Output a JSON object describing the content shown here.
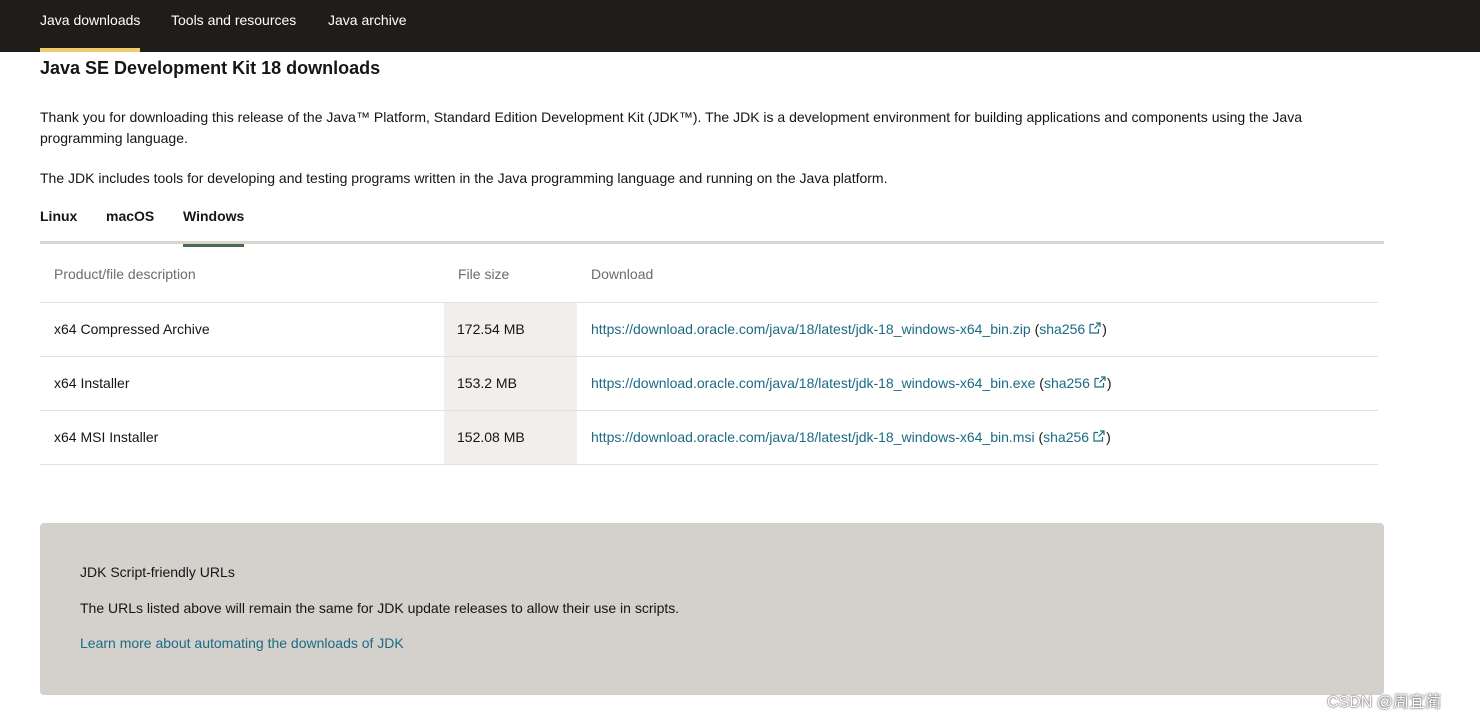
{
  "nav": {
    "items": [
      {
        "label": "Java downloads"
      },
      {
        "label": "Tools and resources"
      },
      {
        "label": "Java archive"
      }
    ]
  },
  "page": {
    "title": "Java SE Development Kit 18 downloads",
    "intro": "Thank you for downloading this release of the Java™ Platform, Standard Edition Development Kit (JDK™). The JDK is a development environment for building applications and components using the Java programming language.",
    "intro2": "The JDK includes tools for developing and testing programs written in the Java programming language and running on the Java platform."
  },
  "tabs": [
    {
      "label": "Linux"
    },
    {
      "label": "macOS"
    },
    {
      "label": "Windows"
    }
  ],
  "table": {
    "headers": [
      "Product/file description",
      "File size",
      "Download"
    ],
    "rows": [
      {
        "description": "x64 Compressed Archive",
        "size": "172.54 MB",
        "url": "https://download.oracle.com/java/18/latest/jdk-18_windows-x64_bin.zip",
        "checksum": "sha256"
      },
      {
        "description": "x64 Installer",
        "size": "153.2 MB",
        "url": "https://download.oracle.com/java/18/latest/jdk-18_windows-x64_bin.exe",
        "checksum": "sha256"
      },
      {
        "description": "x64 MSI Installer",
        "size": "152.08 MB",
        "url": "https://download.oracle.com/java/18/latest/jdk-18_windows-x64_bin.msi",
        "checksum": "sha256"
      }
    ]
  },
  "info_box": {
    "title": "JDK Script-friendly URLs",
    "text": "The URLs listed above will remain the same for JDK update releases to allow their use in scripts.",
    "link": "Learn more about automating the downloads of JDK"
  },
  "watermark": "CSDN @周宜蔺",
  "colors": {
    "nav_bg": "#1f1c1a",
    "nav_active_underline": "#f0cc71",
    "tab_active_underline": "#4a6a52",
    "link": "#1b6b84",
    "info_box_bg": "#d4d0cc",
    "size_column_bg": "#f1efed"
  },
  "icons": {
    "external_link": "external-link-icon"
  }
}
